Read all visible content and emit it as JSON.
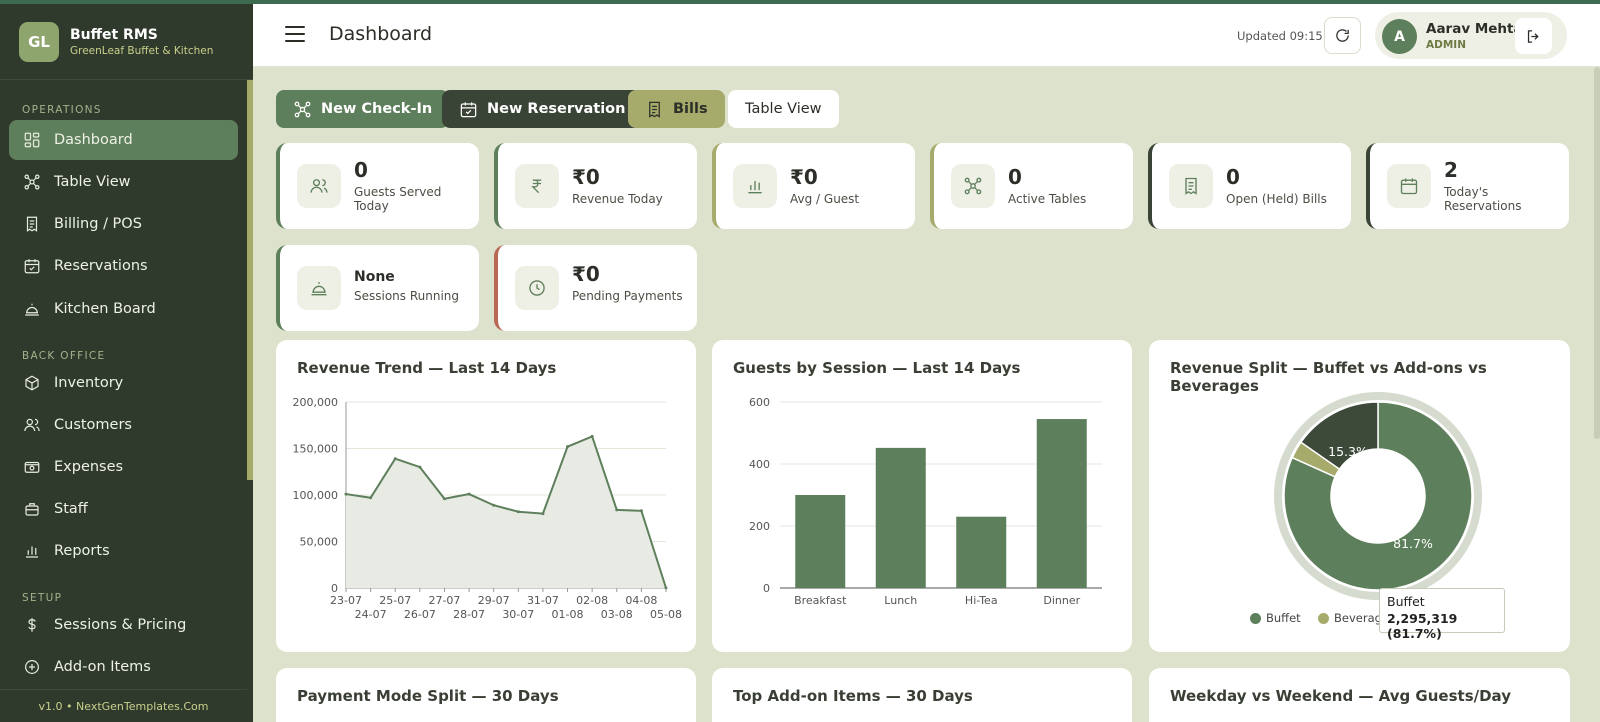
{
  "brand": {
    "logo": "GL",
    "title": "Buffet RMS",
    "subtitle": "GreenLeaf Buffet & Kitchen"
  },
  "sidebar": {
    "sections": [
      "OPERATIONS",
      "BACK OFFICE",
      "SETUP"
    ],
    "items": [
      {
        "label": "Dashboard",
        "icon": "dashboard-icon",
        "active": true
      },
      {
        "label": "Table View",
        "icon": "table-view-icon"
      },
      {
        "label": "Billing / POS",
        "icon": "receipt-icon"
      },
      {
        "label": "Reservations",
        "icon": "calendar-icon"
      },
      {
        "label": "Kitchen Board",
        "icon": "cloche-icon"
      },
      {
        "label": "Inventory",
        "icon": "box-icon"
      },
      {
        "label": "Customers",
        "icon": "users-icon"
      },
      {
        "label": "Expenses",
        "icon": "wallet-icon"
      },
      {
        "label": "Staff",
        "icon": "briefcase-icon"
      },
      {
        "label": "Reports",
        "icon": "bar-chart-icon"
      },
      {
        "label": "Sessions & Pricing",
        "icon": "dollar-icon"
      },
      {
        "label": "Add-on Items",
        "icon": "plus-circle-icon"
      }
    ],
    "footer": "v1.0 • NextGenTemplates.Com"
  },
  "header": {
    "title": "Dashboard",
    "updated": "Updated 09:15",
    "user": {
      "initial": "A",
      "name": "Aarav Mehta",
      "role": "ADMIN"
    }
  },
  "actions": {
    "check_in": "New Check-In",
    "reservation": "New Reservation",
    "bills": "Bills",
    "table_view": "Table View"
  },
  "stats": [
    {
      "value": "0",
      "label": "Guests Served Today",
      "icon": "users-icon",
      "accent": "#5e7f5b"
    },
    {
      "value": "₹0",
      "label": "Revenue Today",
      "icon": "rupee-icon",
      "accent": "#5e7f5b"
    },
    {
      "value": "₹0",
      "label": "Avg / Guest",
      "icon": "bar-chart-icon",
      "accent": "#a6ab6c"
    },
    {
      "value": "0",
      "label": "Active Tables",
      "icon": "table-view-icon",
      "accent": "#a6ab6c"
    },
    {
      "value": "0",
      "label": "Open (Held) Bills",
      "icon": "receipt-icon",
      "accent": "#3a4436"
    },
    {
      "value": "2",
      "label": "Today's Reservations",
      "icon": "calendar-icon",
      "accent": "#3a4436"
    },
    {
      "value": "None",
      "label": "Sessions Running",
      "icon": "cloche-icon",
      "accent": "#5e7f5b"
    },
    {
      "value": "₹0",
      "label": "Pending Payments",
      "icon": "clock-icon",
      "accent": "#b86a55"
    }
  ],
  "cards": {
    "payment_mode": "Payment Mode Split — 30 Days",
    "top_addons": "Top Add-on Items — 30 Days",
    "weekday_weekend": "Weekday vs Weekend — Avg Guests/Day"
  },
  "tooltip": {
    "label": "Buffet",
    "value": "2,295,319 (81.7%)"
  },
  "chart_data": [
    {
      "type": "area",
      "title": "Revenue Trend — Last 14 Days",
      "x": [
        "23-07",
        "24-07",
        "25-07",
        "26-07",
        "27-07",
        "28-07",
        "29-07",
        "30-07",
        "31-07",
        "01-08",
        "02-08",
        "03-08",
        "04-08",
        "05-08"
      ],
      "values": [
        101000,
        97000,
        139000,
        130000,
        96000,
        101000,
        89000,
        82000,
        80000,
        152000,
        163000,
        84000,
        83000,
        0
      ],
      "ylim": [
        0,
        200000
      ],
      "yticks": [
        "0",
        "50,000",
        "100,000",
        "150,000",
        "200,000"
      ],
      "color": "#5e7f5b"
    },
    {
      "type": "bar",
      "title": "Guests by Session — Last 14 Days",
      "categories": [
        "Breakfast",
        "Lunch",
        "Hi-Tea",
        "Dinner"
      ],
      "values": [
        300,
        452,
        230,
        545
      ],
      "ylim": [
        0,
        600
      ],
      "yticks": [
        "0",
        "200",
        "400",
        "600"
      ],
      "color": "#5e7f5b"
    },
    {
      "type": "pie",
      "title": "Revenue Split — Buffet vs Add-ons vs Beverages",
      "series": [
        {
          "name": "Buffet",
          "value": 81.7,
          "color": "#5e7f5b"
        },
        {
          "name": "Beverages",
          "value": 3.0,
          "color": "#a6ab6c"
        },
        {
          "name": "Add-ons",
          "value": 15.3,
          "color": "#3d4a3a"
        }
      ],
      "labels": [
        "81.7%",
        "15.3%"
      ],
      "legend": [
        "Buffet",
        "Beverag"
      ]
    }
  ]
}
